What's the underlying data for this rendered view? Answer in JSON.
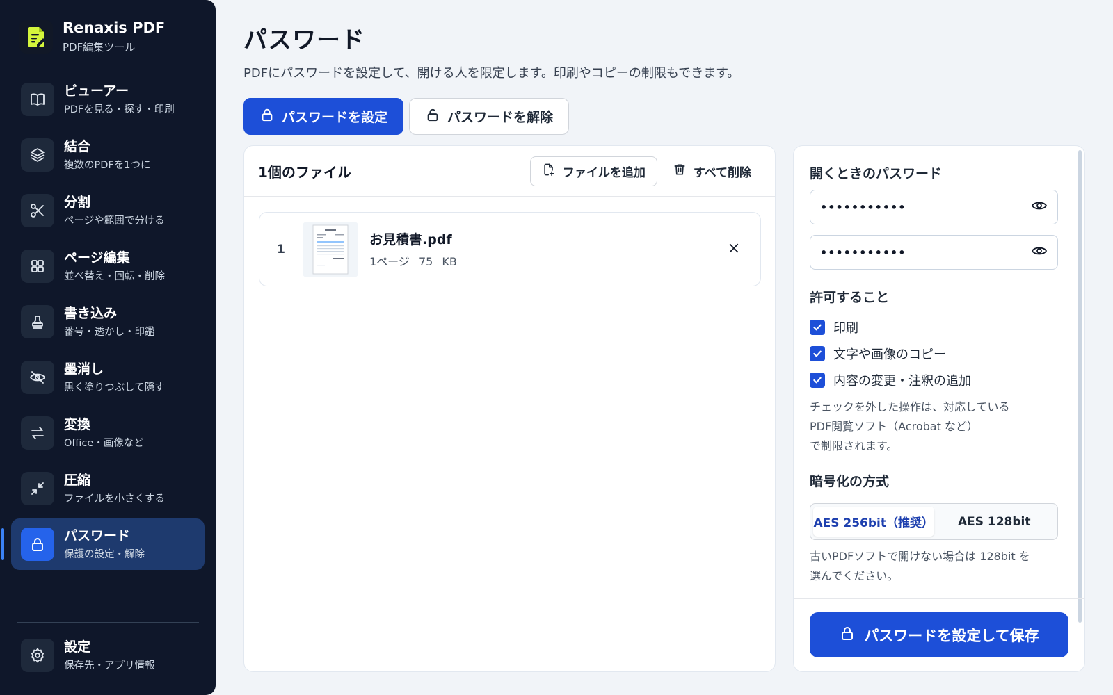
{
  "app": {
    "name": "Renaxis PDF",
    "subtitle": "PDF編集ツール",
    "logo_icon": "pdf-edit-logo"
  },
  "sidebar": {
    "items": [
      {
        "title": "ビューアー",
        "sub": "PDFを見る・探す・印刷",
        "icon": "book-icon"
      },
      {
        "title": "結合",
        "sub": "複数のPDFを1つに",
        "icon": "layers-icon"
      },
      {
        "title": "分割",
        "sub": "ページや範囲で分ける",
        "icon": "scissors-icon"
      },
      {
        "title": "ページ編集",
        "sub": "並べ替え・回転・削除",
        "icon": "grid-icon"
      },
      {
        "title": "書き込み",
        "sub": "番号・透かし・印鑑",
        "icon": "stamp-icon"
      },
      {
        "title": "墨消し",
        "sub": "黒く塗りつぶして隠す",
        "icon": "eye-off-icon"
      },
      {
        "title": "変換",
        "sub": "Office・画像など",
        "icon": "convert-arrows-icon"
      },
      {
        "title": "圧縮",
        "sub": "ファイルを小さくする",
        "icon": "compress-icon"
      },
      {
        "title": "パスワード",
        "sub": "保護の設定・解除",
        "icon": "lock-icon",
        "active": true
      }
    ],
    "settings": {
      "title": "設定",
      "sub": "保存先・アプリ情報",
      "icon": "gear-icon"
    }
  },
  "page": {
    "title": "パスワード",
    "description": "PDFにパスワードを設定して、開ける人を限定します。印刷やコピーの制限もできます。",
    "tabs": [
      {
        "label": "パスワードを設定",
        "active": true
      },
      {
        "label": "パスワードを解除",
        "active": false
      }
    ]
  },
  "files": {
    "count_label": "1個のファイル",
    "add_label": "ファイルを追加",
    "clear_label": "すべて削除",
    "items": [
      {
        "index": "1",
        "name": "お見積書.pdf",
        "meta": "1ページ 75 KB"
      }
    ]
  },
  "options": {
    "open_password_label": "開くときのパスワード",
    "password_value": "•••••••••••",
    "confirm_value": "•••••••••••",
    "permissions_label": "許可すること",
    "permissions": [
      {
        "label": "印刷",
        "checked": true
      },
      {
        "label": "文字や画像のコピー",
        "checked": true
      },
      {
        "label": "内容の変更・注釈の追加",
        "checked": true
      }
    ],
    "permissions_note": [
      "チェックを外した操作は、対応している",
      "PDF閲覧ソフト（Acrobat など）",
      "で制限されます。"
    ],
    "encryption_label": "暗号化の方式",
    "encryption_options": [
      {
        "label": "AES 256bit（推奨）",
        "active": true
      },
      {
        "label": "AES 128bit",
        "active": false
      }
    ],
    "encryption_note": [
      "古いPDFソフトで開けない場合は 128bit を",
      "選んでください。"
    ],
    "save_label": "パスワードを設定して保存"
  },
  "colors": {
    "sidebar_bg": "#0f172a",
    "accent": "#1d4fd8",
    "active_nav": "#1e3a6e",
    "logo_accent": "#d4f53c"
  }
}
